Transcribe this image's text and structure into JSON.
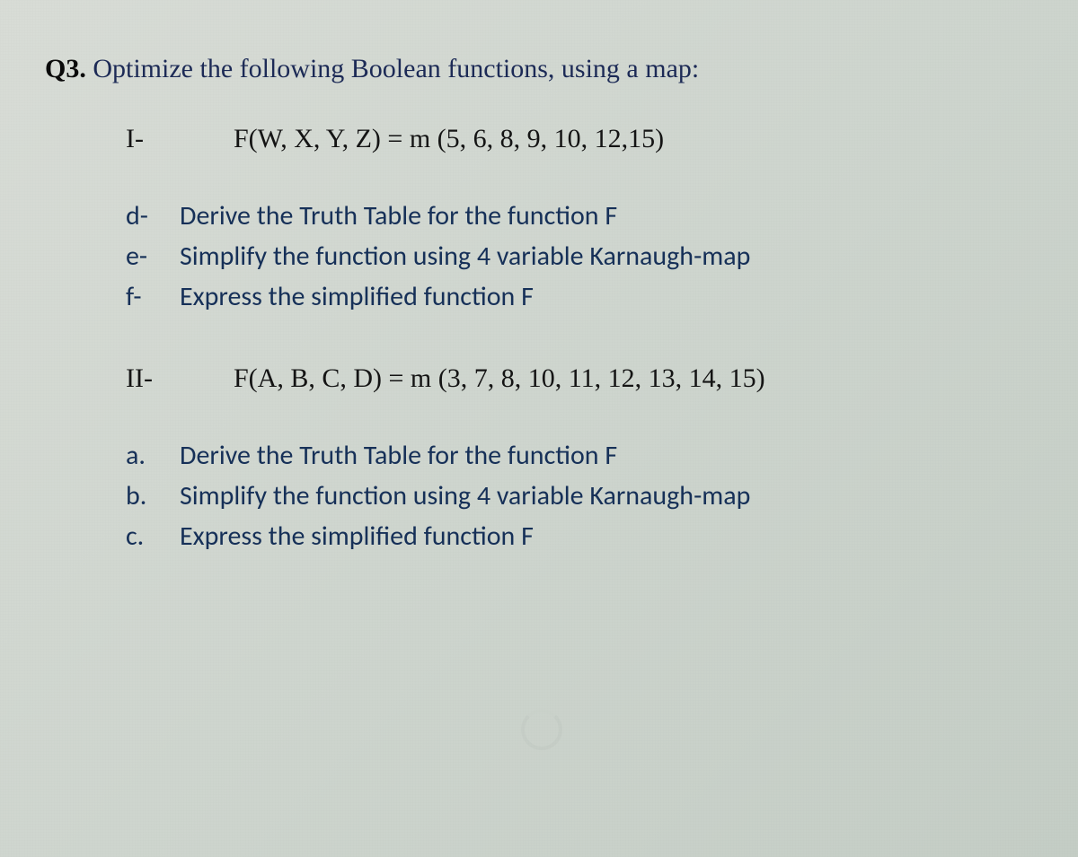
{
  "heading": {
    "label": "Q3.",
    "text": "Optimize the following Boolean functions, using a map:"
  },
  "parts": [
    {
      "marker": "I-",
      "formula": "F(W, X, Y, Z) = m (5, 6, 8, 9, 10, 12,15)",
      "subs": [
        {
          "marker": "d-",
          "text": "Derive the Truth Table for the function F"
        },
        {
          "marker": "e-",
          "text": "Simplify the function using 4 variable Karnaugh-map"
        },
        {
          "marker": "f-",
          "text": "Express the simplified function F"
        }
      ]
    },
    {
      "marker": "II-",
      "formula": "F(A, B, C, D) = m (3, 7, 8, 10, 11, 12, 13, 14, 15)",
      "subs": [
        {
          "marker": "a.",
          "text": "Derive the Truth Table for the function F"
        },
        {
          "marker": "b.",
          "text": "Simplify the function using 4 variable Karnaugh-map"
        },
        {
          "marker": "c.",
          "text": "Express the simplified function F"
        }
      ]
    }
  ]
}
